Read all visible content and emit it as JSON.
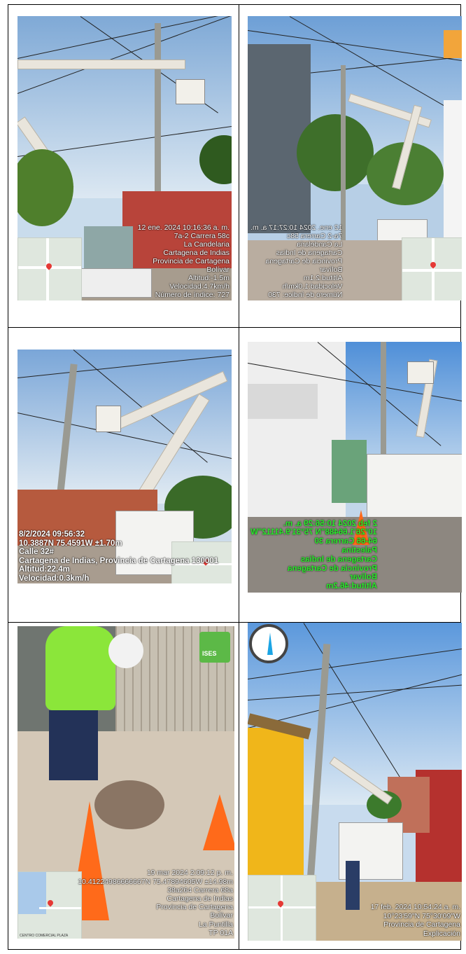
{
  "photos": {
    "p1": {
      "lines": [
        "12 ene. 2024 10:16:36 a. m.",
        "7a-2 Carrera 58c",
        "La Candelaria",
        "Cartagena de Indias",
        "Provincia de Cartagena",
        "Bolívar",
        "Altitud:-1.5m",
        "Velocidad:4.7km/h",
        "Número de índice: 727"
      ]
    },
    "p2": {
      "lines": [
        "12 ene. 2024 10:27:17 a. m.",
        "7a-2 Carrera 58c",
        "La Candelaria",
        "Cartagena de Indias",
        "Provincia de Cartagena",
        "Bolívar",
        "Altitud:2.1m",
        "Velocidad:1.0km/h",
        "Número de índice: 730"
      ]
    },
    "p3": {
      "lines": [
        "8/2/2024 09:56:32",
        "10.3887N 75.4591W ±1.70m",
        "Calle 32#",
        "Cartagena de Indias, Provincia de Cartagena 130001",
        "Altitud:22.4m",
        "Velocidad:0.3km/h"
      ]
    },
    "p4": {
      "lines": [
        "2 feb 2024 10:56:29 a. m.",
        "10°26'1.66488\"N 75°31'9.41112\"W",
        "64-66 Carrera 30",
        "Palestina",
        "Cartagena de Indias",
        "Provincia de Cartagena",
        "Bolívar",
        "Altitud:46.2m"
      ]
    },
    "p5": {
      "logo_text": "ISES",
      "lines": [
        "19 mar 2024 2:09:12 p. m.",
        "10.41224986666667N 75.47894605W ±14.98m",
        "38a264 Carrera 68a",
        "Cartagena de Indias",
        "Provincia de Cartagena",
        "Bolívar",
        "La Puntilla",
        "TP 01A"
      ],
      "map_label": "CENTRO COMERCIAL PLAZA"
    },
    "p6": {
      "lines": [
        "17 feb. 2024 10:54:24 a. m.",
        "10°23'59\"N 75°30'09\"W",
        "Provincia de Cartagena",
        "Explicación"
      ]
    }
  },
  "colors": {
    "stamp_green": "#29e82b",
    "sky": "#cfe2f3",
    "cone": "#ff6a1a",
    "safety_yellow": "#8be63a"
  }
}
